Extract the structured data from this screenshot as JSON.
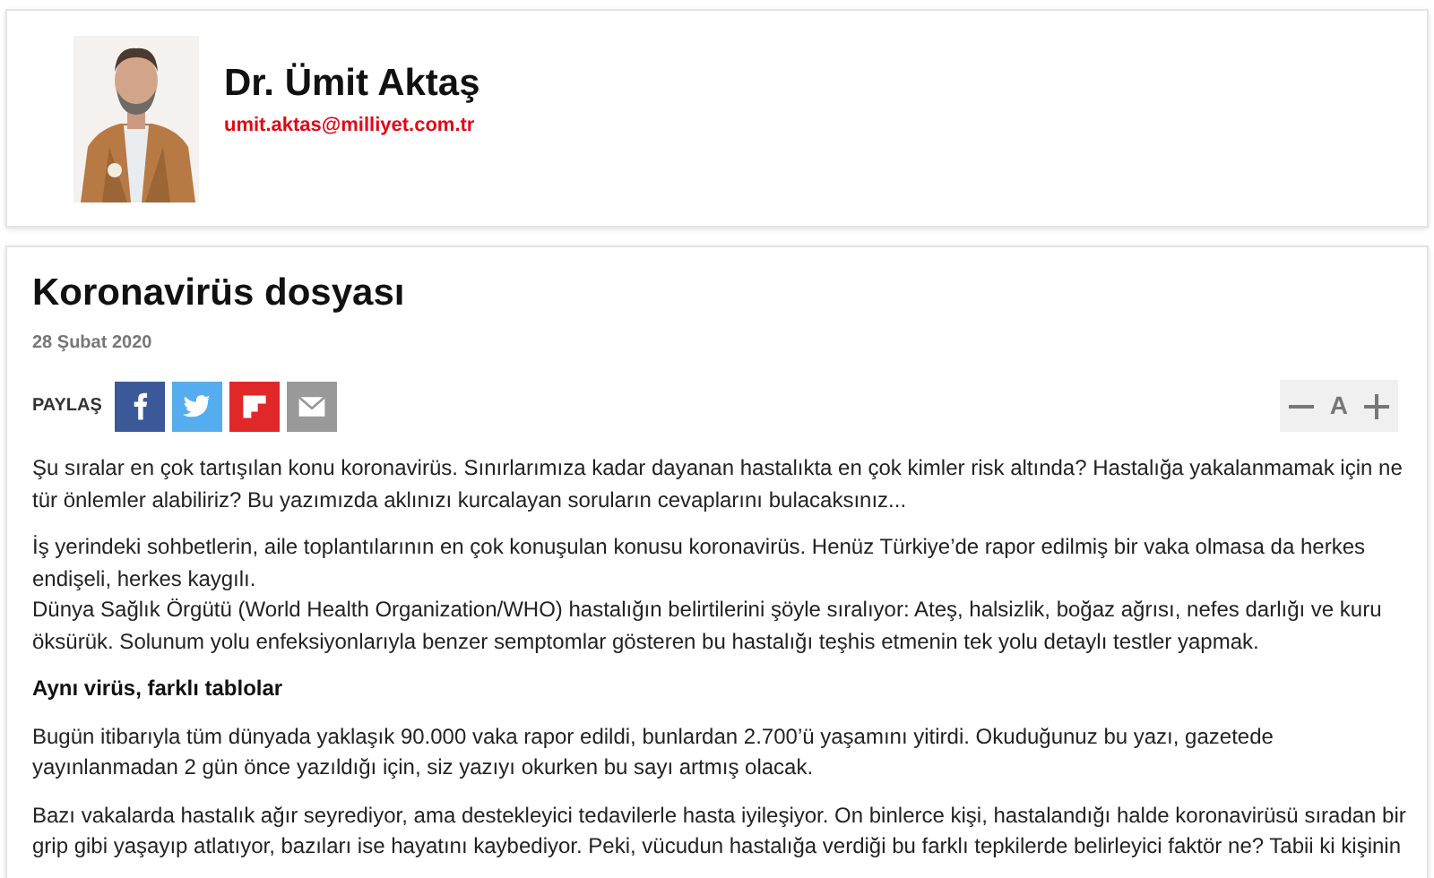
{
  "author": {
    "name": "Dr. Ümit Aktaş",
    "email": "umit.aktas@milliyet.com.tr"
  },
  "article": {
    "title": "Koronavirüs dosyası",
    "date": "28 Şubat 2020",
    "share_label": "PAYLAŞ",
    "share_buttons": [
      {
        "kind": "facebook"
      },
      {
        "kind": "twitter"
      },
      {
        "kind": "flipboard"
      },
      {
        "kind": "email"
      }
    ],
    "font_size_control": {
      "label": "A"
    },
    "body": [
      {
        "kind": "paragraph",
        "text": "Şu sıralar en çok tartışılan konu koronavirüs. Sınırlarımıza kadar dayanan hastalıkta en çok kimler risk altında? Hastalığa yakalanmamak için ne tür önlemler alabiliriz? Bu yazımızda aklınızı kurcalayan soruların cevaplarını bulacaksınız..."
      },
      {
        "kind": "paragraph",
        "text": "İş yerindeki sohbetlerin, aile toplantılarının en çok konuşulan konusu koronavirüs. Henüz Türkiye’de rapor edilmiş bir vaka olmasa da herkes endişeli, herkes kaygılı.\nDünya Sağlık Örgütü (World Health Organization/WHO) hastalığın belirtilerini şöyle sıralıyor: Ateş, halsizlik, boğaz ağrısı, nefes darlığı ve kuru öksürük. Solunum yolu enfeksiyonlarıyla benzer semptomlar gösteren bu hastalığı teşhis etmenin tek yolu detaylı testler yapmak."
      },
      {
        "kind": "heading",
        "text": "Aynı virüs, farklı tablolar"
      },
      {
        "kind": "paragraph",
        "text": "Bugün itibarıyla tüm dünyada yaklaşık 90.000 vaka rapor edildi, bunlardan 2.700’ü yaşamını yitirdi. Okuduğunuz bu yazı, gazetede yayınlanmadan 2 gün önce yazıldığı için, siz yazıyı okurken bu sayı artmış olacak."
      },
      {
        "kind": "paragraph",
        "text": "Bazı vakalarda hastalık ağır seyrediyor, ama destekleyici tedavilerle hasta iyileşiyor. On binlerce kişi, hastalandığı halde koronavirüsü sıradan bir grip gibi yaşayıp atlatıyor, bazıları ise hayatını kaybediyor. Peki, vücudun hastalığa verdiği bu farklı tepkilerde belirleyici faktör ne? Tabii ki kişinin"
      }
    ]
  }
}
